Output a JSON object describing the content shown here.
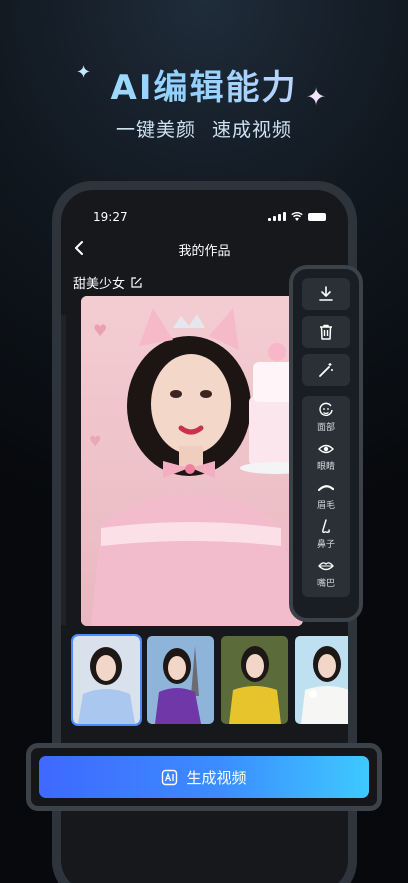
{
  "promo": {
    "headline": "AI编辑能力",
    "subheadline_left": "一键美颜",
    "subheadline_right": "速成视频"
  },
  "status_bar": {
    "time": "19:27"
  },
  "nav": {
    "title": "我的作品"
  },
  "work": {
    "title": "甜美少女"
  },
  "tools": {
    "icons": [
      "download-icon",
      "trash-icon",
      "magic-wand-icon"
    ],
    "features": [
      {
        "label": "面部",
        "icon": "face-icon"
      },
      {
        "label": "眼睛",
        "icon": "eye-icon"
      },
      {
        "label": "眉毛",
        "icon": "eyebrow-icon"
      },
      {
        "label": "鼻子",
        "icon": "nose-icon"
      },
      {
        "label": "嘴巴",
        "icon": "mouth-icon"
      }
    ]
  },
  "thumbnails": [
    {
      "outfit": "blue",
      "selected": true
    },
    {
      "outfit": "purple",
      "selected": false
    },
    {
      "outfit": "yellow",
      "selected": false
    },
    {
      "outfit": "white",
      "selected": false
    }
  ],
  "cta": {
    "label": "生成视频"
  },
  "colors": {
    "accent_start": "#3f68ff",
    "accent_end": "#3ec9ff",
    "selection": "#4a8cff"
  }
}
